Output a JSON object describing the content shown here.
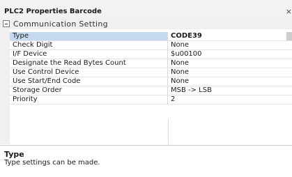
{
  "panel": {
    "title": "PLC2 Properties Barcode",
    "close_glyph": "×"
  },
  "category": {
    "label": "Communication Setting",
    "expander_icon": "minus-box"
  },
  "properties": [
    {
      "name": "Type",
      "value": "CODE39"
    },
    {
      "name": "Check Digit",
      "value": "None"
    },
    {
      "name": "I/F Device",
      "value": "$u00100"
    },
    {
      "name": "Designate the Read Bytes Count",
      "value": " None"
    },
    {
      "name": "Use Control Device",
      "value": " None"
    },
    {
      "name": "Use Start/End Code",
      "value": " None"
    },
    {
      "name": "Storage Order",
      "value": "MSB -> LSB"
    },
    {
      "name": "Priority",
      "value": "2"
    }
  ],
  "description": {
    "title": "Type",
    "text": "Type settings can be made."
  },
  "colors": {
    "selection": "#c7d9f1",
    "category_bg": "#f0f0f0"
  }
}
